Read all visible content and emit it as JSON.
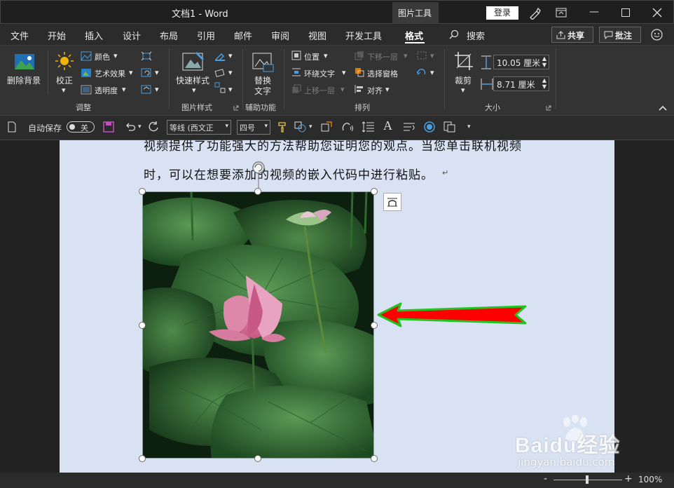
{
  "window": {
    "title": "文档1  -  Word",
    "context_tab": "图片工具",
    "login_label": "登录"
  },
  "tabs": [
    "文件",
    "开始",
    "插入",
    "设计",
    "布局",
    "引用",
    "邮件",
    "审阅",
    "视图",
    "开发工具",
    "格式"
  ],
  "active_tab": "格式",
  "search_label": "搜索",
  "share_label": "共享",
  "comment_label": "批注",
  "ribbon": {
    "remove_bg": "删除背景",
    "correct": "校正",
    "color": "颜色",
    "art_effects": "艺术效果",
    "transparency": "透明度",
    "group_adjust": "调整",
    "quick_styles": "快速样式",
    "group_picture_styles": "图片样式",
    "alt_text_l1": "替换",
    "alt_text_l2": "文字",
    "group_accessibility": "辅助功能",
    "position": "位置",
    "wrap_text": "环绕文字",
    "bring_forward": "上移一层",
    "send_backward": "下移一层",
    "selection_pane": "选择窗格",
    "align": "对齐",
    "group_arrange": "排列",
    "crop": "裁剪",
    "height_value": "10.05 厘米",
    "width_value": "8.71 厘米",
    "group_size": "大小"
  },
  "qat": {
    "autosave_label": "自动保存",
    "autosave_state": "关",
    "font_name": "等线 (西文正⁢",
    "font_size": "四号"
  },
  "document": {
    "line1": "视频提供了功能强大的方法帮助您证明您的观点。当您单击联机视频",
    "line2": "时，可以在想要添加的视频的嵌入代码中进行粘贴。"
  },
  "status": {
    "zoom": "100%"
  },
  "watermark": {
    "brand": "Baidu经验",
    "url": "jingyan.baidu.com"
  },
  "colors": {
    "arrow_fill": "#ff0000",
    "arrow_outline": "#22c322",
    "page_bg": "#d8e2f2"
  }
}
